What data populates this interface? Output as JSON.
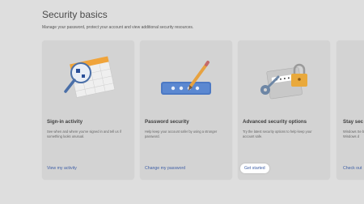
{
  "page": {
    "title": "Security basics",
    "subtitle": "Manage your password, protect your account and view additional security resources."
  },
  "cards": [
    {
      "title": "Sign-in activity",
      "description": "See when and where you've signed in and tell us if something looks unusual.",
      "link": "View my activity"
    },
    {
      "title": "Password security",
      "description": "Help keep your account safer by using a stronger password.",
      "link": "Change my password"
    },
    {
      "title": "Advanced security options",
      "description": "Try the latest security options to help keep your account safe.",
      "link": "Get started"
    },
    {
      "title": "Stay sec",
      "description": "Windows Se built-in pro Windows d",
      "link": "Check out"
    }
  ],
  "colors": {
    "background": "#dedede",
    "card": "#d3d3d3",
    "link": "#3f5fa6",
    "highlight": "#ffffff"
  }
}
